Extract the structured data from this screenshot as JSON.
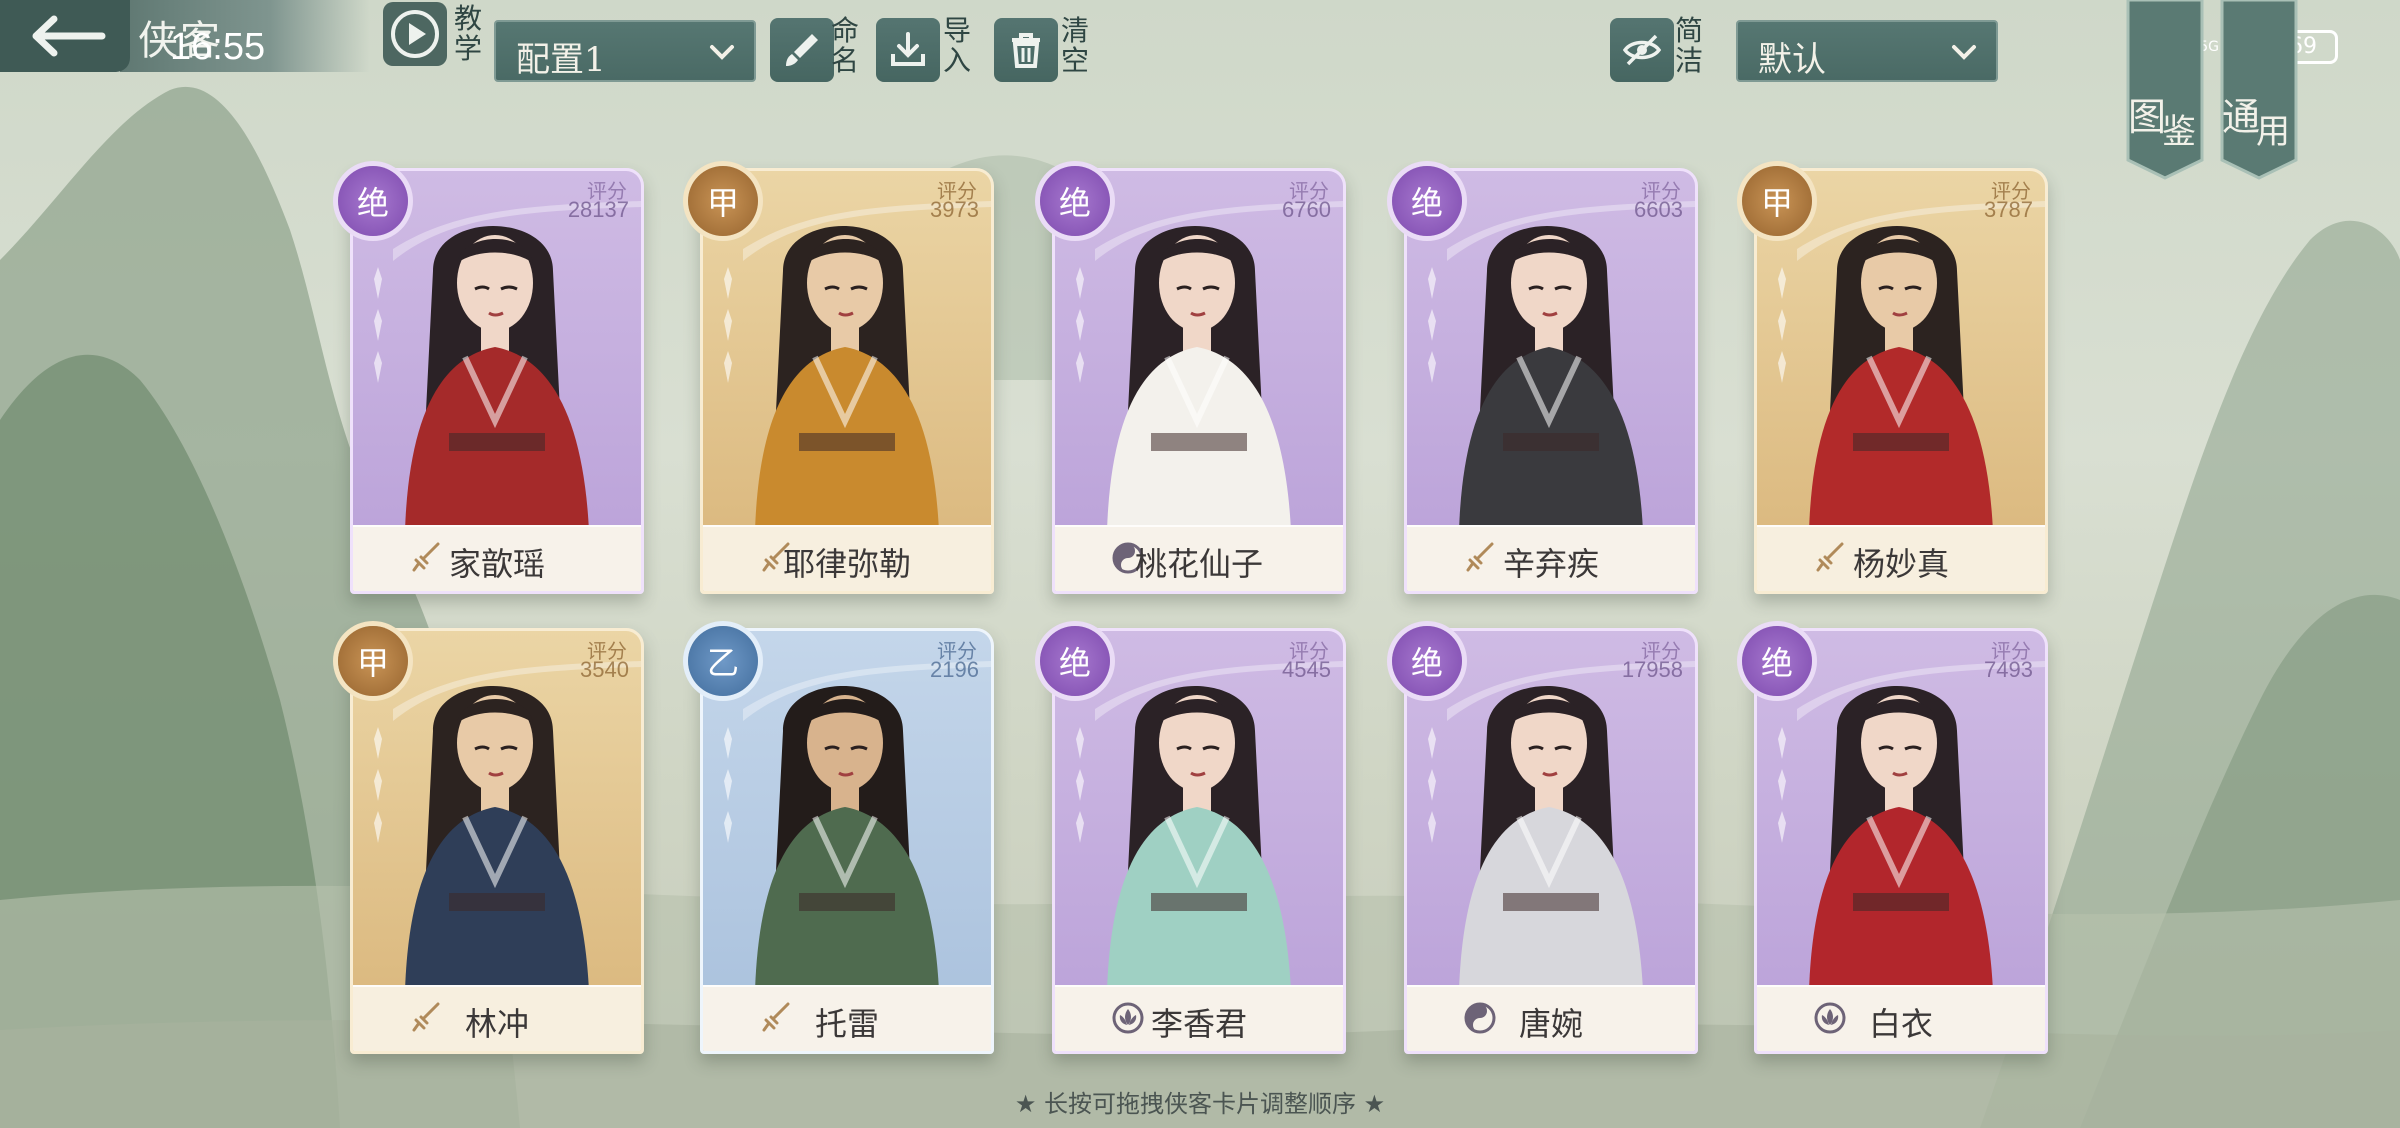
{
  "status_bar": {
    "time": "16:55",
    "network": "4G 5G",
    "battery": "69"
  },
  "header": {
    "title": "侠客",
    "tutorial_label": "教学",
    "config_select": {
      "value": "配置1"
    },
    "rename_label": "命名",
    "import_label": "导入",
    "clear_label": "清空",
    "simple_label": "简洁",
    "sort_select": {
      "value": "默认"
    }
  },
  "side_banners": {
    "gallery": "图鉴",
    "general": "通用"
  },
  "rating_label": "评分",
  "cards": [
    {
      "name": "家歆瑶",
      "tier": "绝",
      "rating": "28137",
      "role": "sword"
    },
    {
      "name": "耶律弥勒",
      "tier": "甲",
      "rating": "3973",
      "role": "sword"
    },
    {
      "name": "桃花仙子",
      "tier": "绝",
      "rating": "6760",
      "role": "taiji"
    },
    {
      "name": "辛弃疾",
      "tier": "绝",
      "rating": "6603",
      "role": "sword"
    },
    {
      "name": "杨妙真",
      "tier": "甲",
      "rating": "3787",
      "role": "sword"
    },
    {
      "name": "林冲",
      "tier": "甲",
      "rating": "3540",
      "role": "sword"
    },
    {
      "name": "托雷",
      "tier": "乙",
      "rating": "2196",
      "role": "sword"
    },
    {
      "name": "李香君",
      "tier": "绝",
      "rating": "4545",
      "role": "lotus"
    },
    {
      "name": "唐婉",
      "tier": "绝",
      "rating": "17958",
      "role": "taiji"
    },
    {
      "name": "白衣",
      "tier": "绝",
      "rating": "7493",
      "role": "lotus"
    }
  ],
  "hint": "★ 长按可拖拽侠客卡片调整顺序 ★",
  "colors": {
    "toolbar": "#4a6a65",
    "purple_card": "#b9a0d8",
    "gold_card": "#d9b57a",
    "blue_card": "#a8c0dc"
  }
}
